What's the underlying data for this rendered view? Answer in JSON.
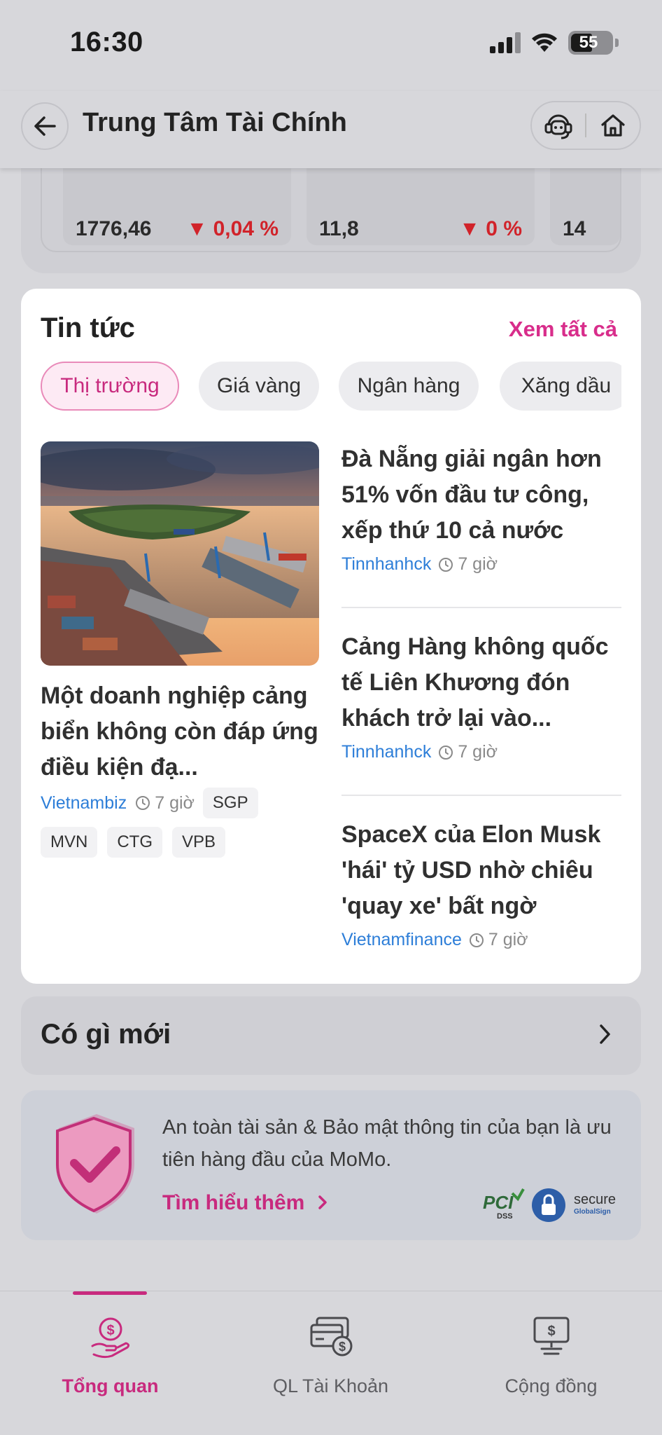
{
  "status_bar": {
    "time": "16:30",
    "battery": "55"
  },
  "header": {
    "title": "Trung Tâm Tài Chính"
  },
  "indices": [
    {
      "value": "1776,46",
      "change": "0,04 %",
      "direction": "down"
    },
    {
      "value": "11,8",
      "change": "0 %",
      "direction": "down"
    },
    {
      "value": "14"
    }
  ],
  "news": {
    "title": "Tin tức",
    "see_all": "Xem tất cả",
    "chips": [
      "Thị trường",
      "Giá vàng",
      "Ngân hàng",
      "Xăng dầu"
    ],
    "featured": {
      "title": "Một doanh nghiệp cảng biển không còn đáp ứng điều kiện đạ...",
      "source": "Vietnambiz",
      "time": "7 giờ",
      "tags": [
        "SGP",
        "MVN",
        "CTG",
        "VPB"
      ]
    },
    "items": [
      {
        "title": "Đà Nẵng giải ngân hơn 51% vốn đầu tư công, xếp thứ 10 cả nước",
        "source": "Tinnhanhck",
        "time": "7 giờ"
      },
      {
        "title": "Cảng Hàng không quốc tế Liên Khương đón khách trở lại vào...",
        "source": "Tinnhanhck",
        "time": "7 giờ"
      },
      {
        "title": "SpaceX của Elon Musk 'hái' tỷ USD nhờ chiêu 'quay xe' bất ngờ",
        "source": "Vietnamfinance",
        "time": "7 giờ"
      }
    ]
  },
  "whats_new": {
    "title": "Có gì mới"
  },
  "security": {
    "text": "An toàn tài sản & Bảo mật thông tin của bạn là ưu tiên hàng đầu của MoMo.",
    "link": "Tìm hiểu thêm",
    "badges": [
      "PCI DSS",
      "SSL",
      "secure GlobalSign"
    ]
  },
  "tabbar": {
    "tabs": [
      {
        "label": "Tổng quan",
        "icon": "money-hand-icon",
        "active": true
      },
      {
        "label": "QL Tài Khoản",
        "icon": "cards-dollar-icon",
        "active": false
      },
      {
        "label": "Cộng đồng",
        "icon": "monitor-dollar-icon",
        "active": false
      }
    ]
  },
  "colors": {
    "accent": "#c82a7e",
    "link": "#2d7ed8",
    "down": "#d1232a"
  }
}
